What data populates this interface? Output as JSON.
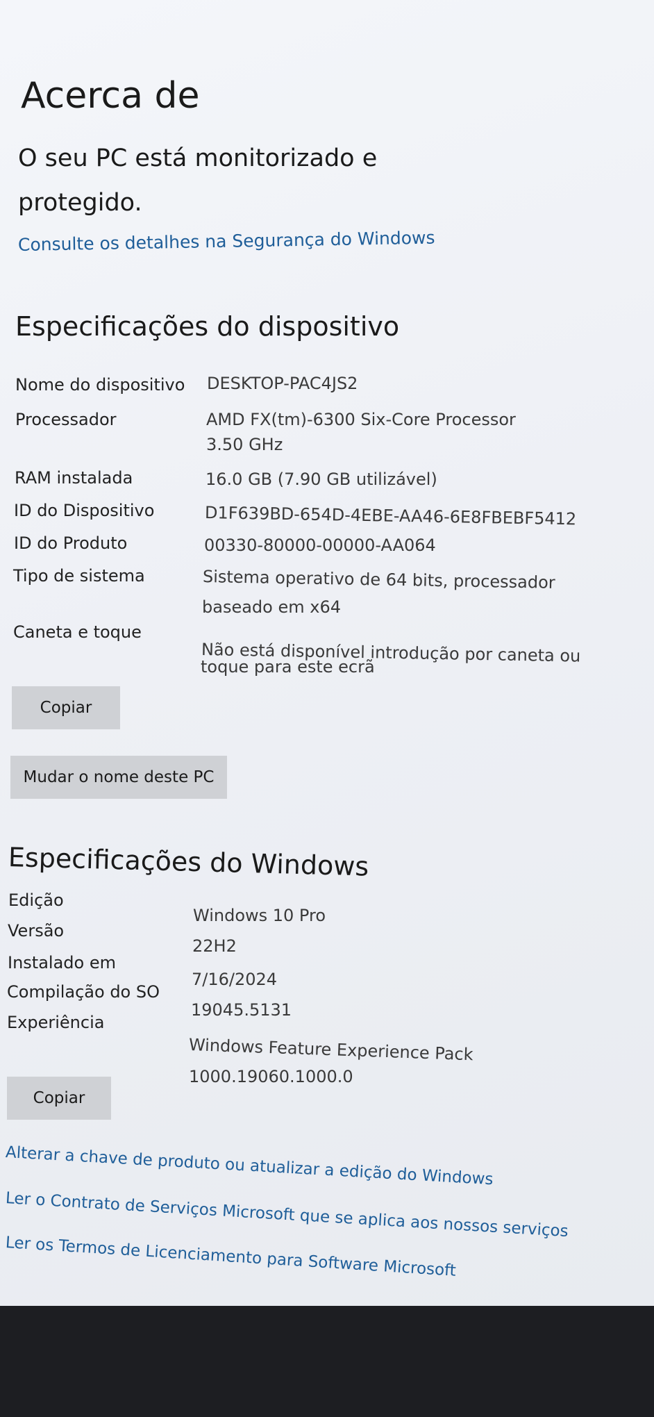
{
  "page": {
    "title": "Acerca de",
    "status": "O seu PC está monitorizado e protegido.",
    "security_link": "Consulte os detalhes na Segurança do Windows"
  },
  "device_specs": {
    "heading": "Especificações do dispositivo",
    "rows": [
      {
        "label": "Nome do dispositivo",
        "value": "DESKTOP-PAC4JS2"
      },
      {
        "label": "Processador",
        "value": "AMD FX(tm)-6300 Six-Core Processor",
        "value2": "3.50 GHz"
      },
      {
        "label": "RAM instalada",
        "value": "16.0 GB (7.90 GB utilizável)"
      },
      {
        "label": "ID do Dispositivo",
        "value": "D1F639BD-654D-4EBE-AA46-6E8FBEBF5412"
      },
      {
        "label": "ID do Produto",
        "value": "00330-80000-00000-AA064"
      },
      {
        "label": "Tipo de sistema",
        "value": "Sistema operativo de 64 bits, processador",
        "value2": "baseado em x64"
      },
      {
        "label": "Caneta e toque",
        "value": "Não está disponível introdução por caneta ou",
        "value2": "toque para este ecrã"
      }
    ],
    "copy_button": "Copiar",
    "rename_button": "Mudar o nome deste PC"
  },
  "windows_specs": {
    "heading": "Especificações do Windows",
    "rows": [
      {
        "label": "Edição",
        "value": "Windows 10 Pro"
      },
      {
        "label": "Versão",
        "value": "22H2"
      },
      {
        "label": "Instalado em",
        "value": "7/16/2024"
      },
      {
        "label": "Compilação do SO",
        "value": "19045.5131"
      },
      {
        "label": "Experiência",
        "value": "Windows Feature Experience Pack",
        "value2": "1000.19060.1000.0"
      }
    ],
    "copy_button": "Copiar"
  },
  "links": [
    "Alterar a chave de produto ou atualizar a edição do Windows",
    "Ler o Contrato de Serviços Microsoft que se aplica aos nossos serviços",
    "Ler os Termos de Licenciamento para Software Microsoft"
  ],
  "colors": {
    "link": "#1f5e99",
    "button": "#cfd1d5",
    "background": "#eef0f5"
  }
}
